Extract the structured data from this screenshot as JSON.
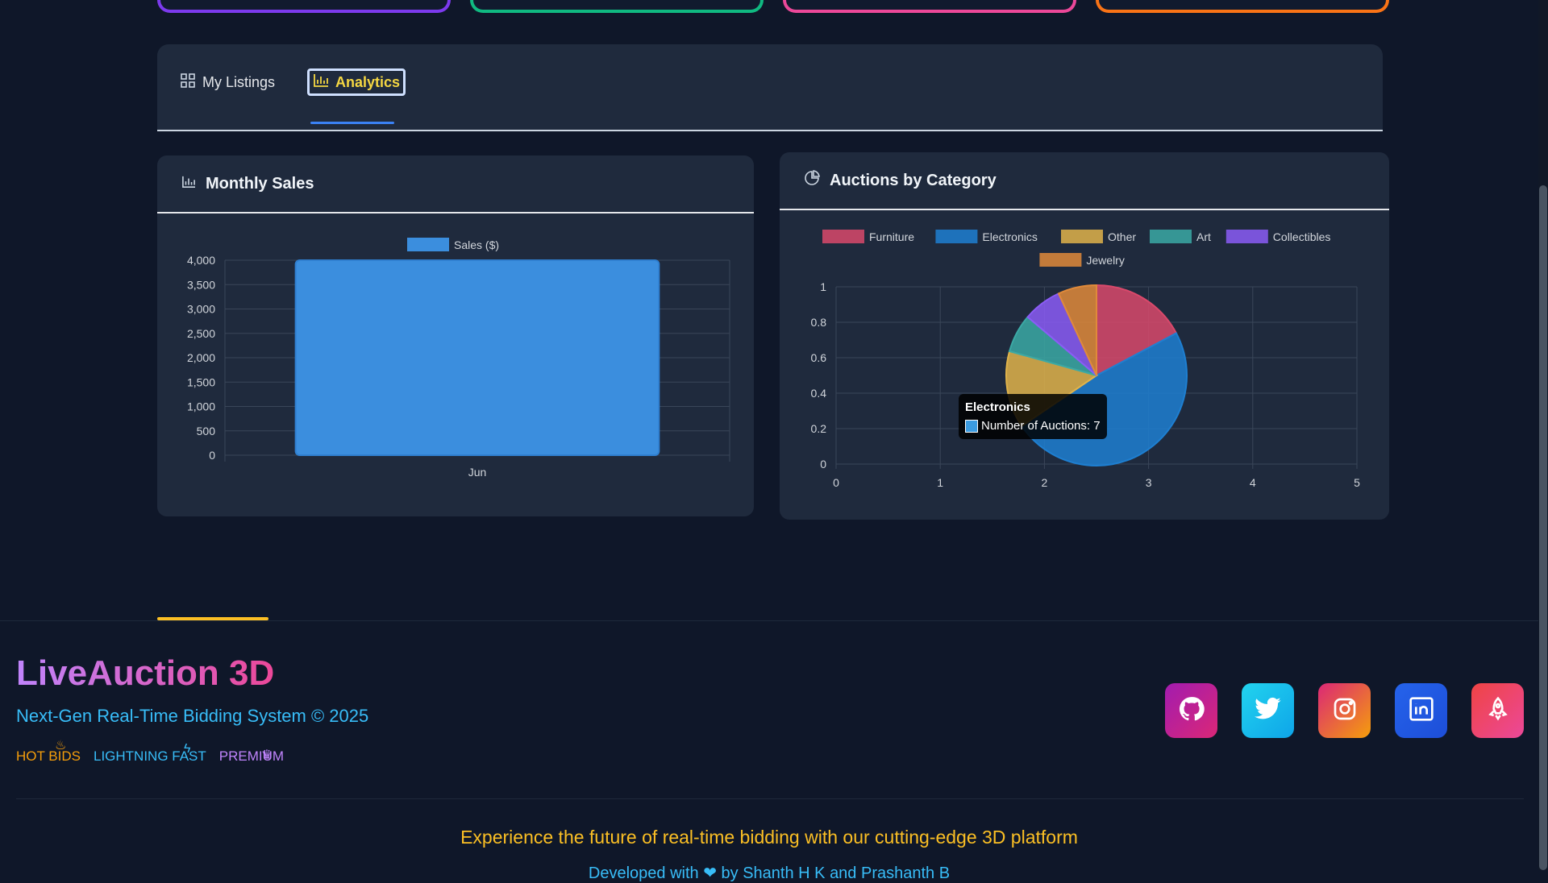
{
  "top_cards": [
    {
      "color": "#7c3aed"
    },
    {
      "color": "#10b981"
    },
    {
      "color": "#ec4899"
    },
    {
      "color": "#f97316"
    }
  ],
  "tabs": [
    {
      "label": "My Listings",
      "icon": "grid-icon",
      "active": false
    },
    {
      "label": "Analytics",
      "icon": "bar-chart-icon",
      "active": true
    }
  ],
  "monthly_sales": {
    "title": "Monthly Sales",
    "icon": "bar-chart-icon"
  },
  "auctions_by_category": {
    "title": "Auctions by Category",
    "icon": "pie-chart-icon",
    "tooltip": {
      "title": "Electronics",
      "label": "Number of Auctions: 7"
    }
  },
  "chart_data": [
    {
      "type": "bar",
      "title": "Monthly Sales",
      "categories": [
        "Jun"
      ],
      "series": [
        {
          "name": "Sales ($)",
          "values": [
            4000
          ],
          "color": "#3b8ede"
        }
      ],
      "ylim": [
        0,
        4000
      ],
      "yticks": [
        "4,000",
        "3,500",
        "3,000",
        "2,500",
        "2,000",
        "1,500",
        "1,000",
        "500",
        "0"
      ],
      "grid": true,
      "legend": "top"
    },
    {
      "type": "pie",
      "title": "Auctions by Category",
      "categories": [
        "Furniture",
        "Electronics",
        "Other",
        "Art",
        "Collectibles",
        "Jewelry"
      ],
      "values": [
        2.5,
        7,
        2,
        1,
        1,
        1
      ],
      "colors": [
        "#d9496b",
        "#1e7fd1",
        "#e0b34a",
        "#3ba9a5",
        "#8b5cf6",
        "#e08a3a"
      ],
      "ylim": [
        0,
        1
      ],
      "xlim": [
        0,
        5
      ],
      "yticks": [
        "1",
        "0.8",
        "0.6",
        "0.4",
        "0.2",
        "0"
      ],
      "xticks": [
        "0",
        "1",
        "2",
        "3",
        "4",
        "5"
      ],
      "grid": true,
      "legend": "top"
    }
  ],
  "footer": {
    "brand": "LiveAuction 3D",
    "tagline": "Next-Gen Real-Time Bidding System © 2025",
    "badges": [
      {
        "label": "HOT BIDS",
        "color": "#f59e0b",
        "icon": "fire-icon"
      },
      {
        "label": "LIGHTNING FAST",
        "color": "#38bdf8",
        "icon": "lightning-icon"
      },
      {
        "label": "PREMIUM",
        "color": "#c084fc",
        "icon": "crown-icon"
      }
    ],
    "socials": [
      {
        "name": "github",
        "icon": "github-icon",
        "bg": "linear-gradient(135deg,#a21caf,#db2777)"
      },
      {
        "name": "twitter",
        "icon": "twitter-icon",
        "bg": "linear-gradient(135deg,#22d3ee,#0ea5e9)"
      },
      {
        "name": "instagram",
        "icon": "instagram-icon",
        "bg": "linear-gradient(135deg,#db2777,#f59e0b)"
      },
      {
        "name": "linkedin",
        "icon": "linkedin-icon",
        "bg": "linear-gradient(135deg,#2563eb,#1d4ed8)"
      },
      {
        "name": "rocket",
        "icon": "rocket-icon",
        "bg": "linear-gradient(135deg,#ef4444,#ec4899)"
      }
    ],
    "experience": "Experience the future of real-time bidding with our cutting-edge 3D platform",
    "developed": "Developed with ❤ by Shanth H K and Prashanth B"
  }
}
